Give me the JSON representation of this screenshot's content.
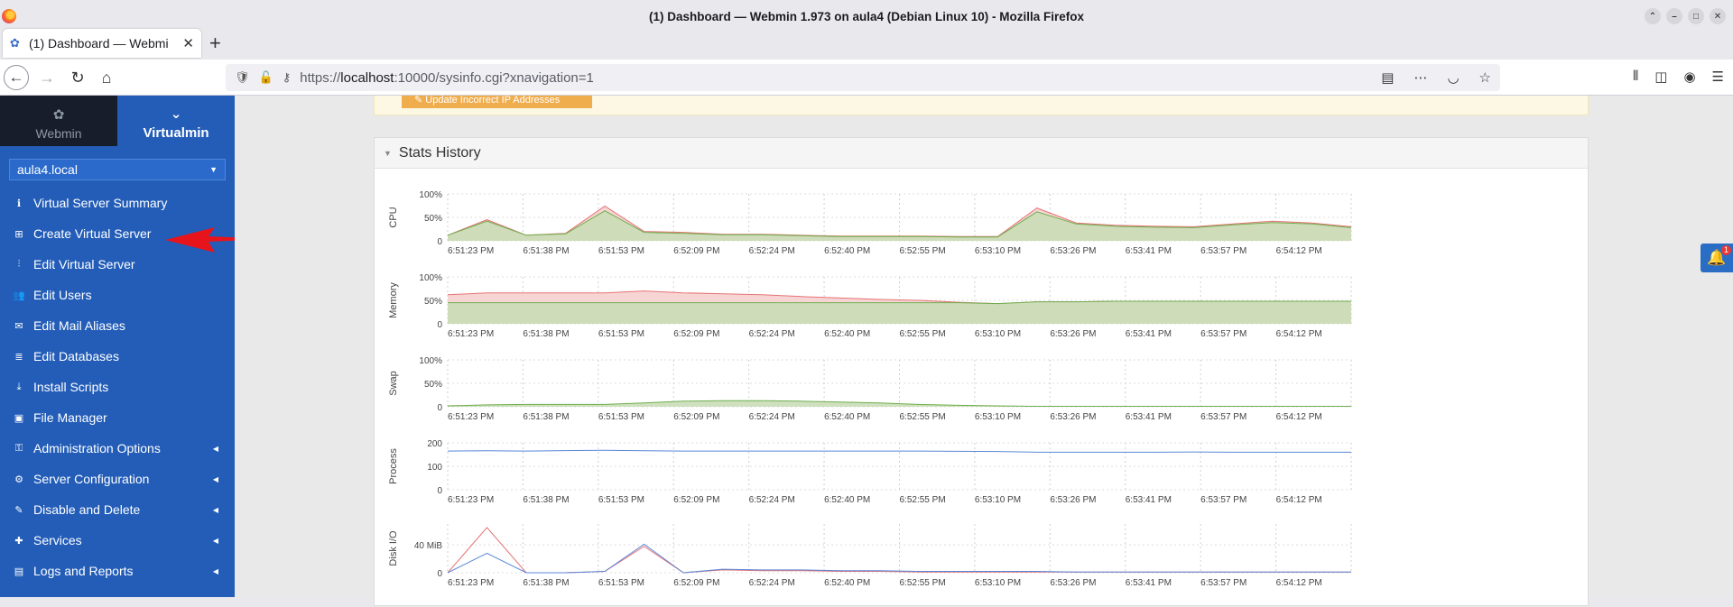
{
  "browser": {
    "window_title": "(1) Dashboard — Webmin 1.973 on aula4 (Debian Linux 10) - Mozilla Firefox",
    "tab_title": "(1) Dashboard — Webmi",
    "url_prefix": "https://",
    "url_host": "localhost",
    "url_rest": ":10000/sysinfo.cgi?xnavigation=1"
  },
  "sidebar": {
    "tab_webmin": "Webmin",
    "tab_virtualmin": "Virtualmin",
    "domain_select": "aula4.local",
    "items": [
      {
        "label": "Virtual Server Summary",
        "icon": "info-icon"
      },
      {
        "label": "Create Virtual Server",
        "icon": "server-add-icon"
      },
      {
        "label": "Edit Virtual Server",
        "icon": "sliders-icon"
      },
      {
        "label": "Edit Users",
        "icon": "users-icon"
      },
      {
        "label": "Edit Mail Aliases",
        "icon": "mail-alias-icon"
      },
      {
        "label": "Edit Databases",
        "icon": "database-icon"
      },
      {
        "label": "Install Scripts",
        "icon": "install-icon"
      },
      {
        "label": "File Manager",
        "icon": "folder-icon"
      },
      {
        "label": "Administration Options",
        "icon": "key-icon",
        "submenu": true
      },
      {
        "label": "Server Configuration",
        "icon": "gears-icon",
        "submenu": true
      },
      {
        "label": "Disable and Delete",
        "icon": "wrench-icon",
        "submenu": true
      },
      {
        "label": "Services",
        "icon": "puzzle-icon",
        "submenu": true
      },
      {
        "label": "Logs and Reports",
        "icon": "file-icon",
        "submenu": true
      }
    ]
  },
  "alert": {
    "button_label": "Update Incorrect IP Addresses"
  },
  "stats": {
    "title": "Stats History",
    "notification_count": "1"
  },
  "colors": {
    "sidebar_bg": "#235db8",
    "cpu_fill": "#c9ddb6",
    "memory_fill": "#f7d0d0",
    "series_green": "#6fae4f",
    "series_red": "#e57373",
    "series_blue": "#5a87d8"
  },
  "chart_data": [
    {
      "type": "area",
      "ylabel": "CPU",
      "yticks": [
        "100%",
        "50%",
        "0"
      ],
      "ylim": [
        0,
        100
      ],
      "x": [
        "6:51:23 PM",
        "6:51:38 PM",
        "6:51:53 PM",
        "6:52:09 PM",
        "6:52:24 PM",
        "6:52:40 PM",
        "6:52:55 PM",
        "6:53:10 PM",
        "6:53:26 PM",
        "6:53:41 PM",
        "6:53:57 PM",
        "6:54:12 PM"
      ],
      "series": [
        {
          "color": "#e57373",
          "values": [
            12,
            45,
            12,
            16,
            74,
            20,
            18,
            14,
            14,
            12,
            10,
            10,
            10,
            9,
            9,
            70,
            38,
            33,
            31,
            30,
            36,
            42,
            38,
            30
          ]
        },
        {
          "color": "#6fae4f",
          "values": [
            12,
            42,
            12,
            15,
            64,
            18,
            16,
            13,
            13,
            11,
            9,
            9,
            9,
            8,
            8,
            62,
            36,
            31,
            29,
            28,
            34,
            39,
            36,
            28
          ]
        }
      ]
    },
    {
      "type": "area",
      "ylabel": "Memory",
      "yticks": [
        "100%",
        "50%",
        "0"
      ],
      "ylim": [
        0,
        100
      ],
      "x": [
        "6:51:23 PM",
        "6:51:38 PM",
        "6:51:53 PM",
        "6:52:09 PM",
        "6:52:24 PM",
        "6:52:40 PM",
        "6:52:55 PM",
        "6:53:10 PM",
        "6:53:26 PM",
        "6:53:41 PM",
        "6:53:57 PM",
        "6:54:12 PM"
      ],
      "series": [
        {
          "color": "#e57373",
          "values": [
            62,
            66,
            66,
            66,
            66,
            70,
            66,
            64,
            62,
            58,
            55,
            52,
            50,
            46,
            43,
            47,
            47,
            48,
            48,
            48,
            48,
            48,
            48,
            48
          ]
        },
        {
          "color": "#6fae4f",
          "values": [
            45,
            45,
            45,
            45,
            45,
            45,
            45,
            45,
            45,
            45,
            45,
            45,
            45,
            45,
            43,
            47,
            47,
            48,
            48,
            48,
            48,
            48,
            48,
            48
          ]
        }
      ]
    },
    {
      "type": "area",
      "ylabel": "Swap",
      "yticks": [
        "100%",
        "50%",
        "0"
      ],
      "ylim": [
        0,
        100
      ],
      "x": [
        "6:51:23 PM",
        "6:51:38 PM",
        "6:51:53 PM",
        "6:52:09 PM",
        "6:52:24 PM",
        "6:52:40 PM",
        "6:52:55 PM",
        "6:53:10 PM",
        "6:53:26 PM",
        "6:53:41 PM",
        "6:53:57 PM",
        "6:54:12 PM"
      ],
      "series": [
        {
          "color": "#6fae4f",
          "values": [
            2,
            4,
            5,
            5,
            5,
            8,
            12,
            13,
            13,
            12,
            10,
            8,
            5,
            3,
            2,
            1,
            1,
            1,
            1,
            1,
            1,
            1,
            1,
            1
          ]
        }
      ]
    },
    {
      "type": "line",
      "ylabel": "Process",
      "yticks": [
        "200",
        "100",
        "0"
      ],
      "ylim": [
        0,
        200
      ],
      "x": [
        "6:51:23 PM",
        "6:51:38 PM",
        "6:51:53 PM",
        "6:52:09 PM",
        "6:52:24 PM",
        "6:52:40 PM",
        "6:52:55 PM",
        "6:53:10 PM",
        "6:53:26 PM",
        "6:53:41 PM",
        "6:53:57 PM",
        "6:54:12 PM"
      ],
      "series": [
        {
          "color": "#5a87d8",
          "values": [
            165,
            166,
            165,
            167,
            168,
            166,
            165,
            165,
            165,
            165,
            165,
            165,
            165,
            164,
            163,
            160,
            160,
            160,
            160,
            161,
            160,
            160,
            160,
            160
          ]
        }
      ]
    },
    {
      "type": "line",
      "ylabel": "Disk I/O",
      "yticks": [
        "40 MiB",
        "0"
      ],
      "ylim": [
        0,
        70
      ],
      "x": [
        "6:51:23 PM",
        "6:51:38 PM",
        "6:51:53 PM",
        "6:52:09 PM",
        "6:52:24 PM",
        "6:52:40 PM",
        "6:52:55 PM",
        "6:53:10 PM",
        "6:53:26 PM",
        "6:53:41 PM",
        "6:53:57 PM",
        "6:54:12 PM"
      ],
      "series": [
        {
          "color": "#e57373",
          "values": [
            0,
            65,
            0,
            0,
            2,
            38,
            0,
            4,
            3,
            3,
            2,
            2,
            1,
            1,
            1,
            1,
            1,
            1,
            1,
            1,
            1,
            1,
            1,
            1
          ]
        },
        {
          "color": "#5a87d8",
          "values": [
            0,
            28,
            0,
            0,
            2,
            41,
            0,
            5,
            4,
            4,
            3,
            3,
            2,
            2,
            2,
            2,
            1,
            1,
            1,
            1,
            1,
            1,
            1,
            1
          ]
        }
      ]
    }
  ]
}
